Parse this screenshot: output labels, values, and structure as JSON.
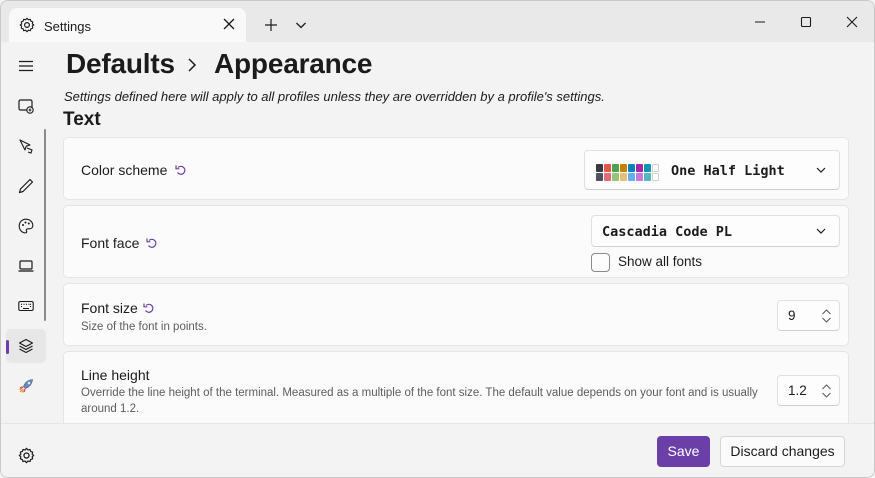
{
  "window": {
    "tab_title": "Settings",
    "icons": {
      "tab": "gear-icon",
      "tab_close": "close-icon",
      "new_tab": "plus-icon",
      "tab_menu": "chevron-down-icon",
      "minimize": "minimize-icon",
      "maximize": "maximize-icon",
      "close": "close-icon"
    }
  },
  "rail": {
    "items": [
      {
        "icon": "hamburger-menu-icon"
      },
      {
        "icon": "launch-icon"
      },
      {
        "icon": "interaction-icon"
      },
      {
        "icon": "pen-icon"
      },
      {
        "icon": "palette-icon"
      },
      {
        "icon": "laptop-icon"
      },
      {
        "icon": "keyboard-icon"
      },
      {
        "icon": "layers-icon",
        "selected": true
      },
      {
        "icon": "rocket-icon"
      }
    ],
    "settings_icon": "gear-icon"
  },
  "header": {
    "crumb_parent": "Defaults",
    "crumb_current": "Appearance",
    "description": "Settings defined here will apply to all profiles unless they are overridden by a profile's settings."
  },
  "section": {
    "title": "Text"
  },
  "settings": {
    "color_scheme": {
      "label": "Color scheme",
      "value": "One Half Light",
      "swatches": [
        "#383a42",
        "#e45649",
        "#50a14f",
        "#c18401",
        "#0184bc",
        "#a626a4",
        "#0997b3",
        "#fafafa",
        "#4f525e",
        "#e06c75",
        "#98c379",
        "#e5c07b",
        "#61afef",
        "#c678dd",
        "#56b6c2",
        "#ffffff"
      ]
    },
    "font_face": {
      "label": "Font face",
      "value": "Cascadia Code PL",
      "show_all_label": "Show all fonts",
      "show_all_checked": false
    },
    "font_size": {
      "label": "Font size",
      "sub": "Size of the font in points.",
      "value": "9"
    },
    "line_height": {
      "label": "Line height",
      "sub": "Override the line height of the terminal. Measured as a multiple of the font size. The default value depends on your font and is usually around 1.2.",
      "value": "1.2"
    }
  },
  "footer": {
    "save_label": "Save",
    "discard_label": "Discard changes"
  },
  "colors": {
    "accent": "#6b3fa8",
    "background": "#f3f3f3",
    "card": "#fbfbfb"
  }
}
